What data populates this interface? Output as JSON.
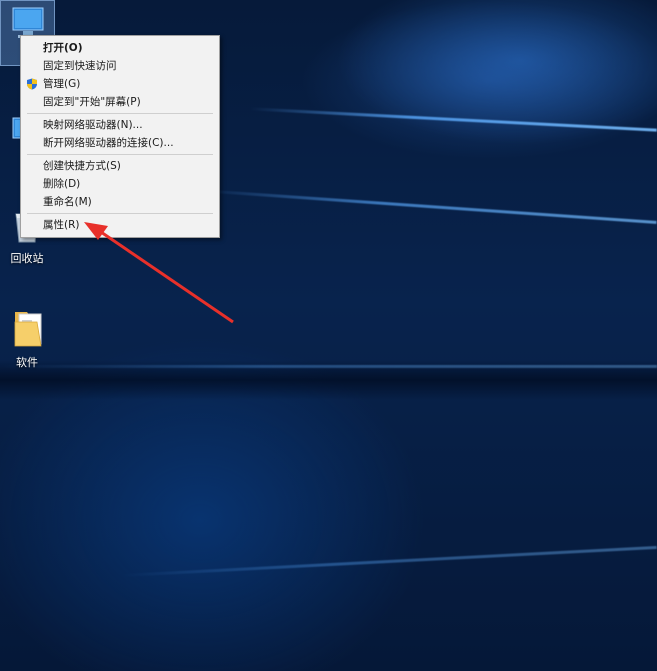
{
  "desktop": {
    "icons": [
      {
        "name": "this-pc",
        "label": ""
      },
      {
        "name": "network",
        "label": ""
      },
      {
        "name": "recycle-bin",
        "label": "回收站"
      },
      {
        "name": "software-folder",
        "label": "软件"
      }
    ]
  },
  "context_menu": {
    "items": [
      {
        "label": "打开(O)",
        "bold": true
      },
      {
        "label": "固定到快速访问"
      },
      {
        "label": "管理(G)",
        "icon": "uac-shield-icon"
      },
      {
        "label": "固定到\"开始\"屏幕(P)"
      },
      {
        "label": "映射网络驱动器(N)..."
      },
      {
        "label": "断开网络驱动器的连接(C)..."
      },
      {
        "label": "创建快捷方式(S)"
      },
      {
        "label": "删除(D)"
      },
      {
        "label": "重命名(M)"
      },
      {
        "label": "属性(R)"
      }
    ]
  },
  "colors": {
    "wallpaper": "#08234d",
    "menu_bg": "#f2f2f2",
    "arrow": "#e8302a"
  }
}
